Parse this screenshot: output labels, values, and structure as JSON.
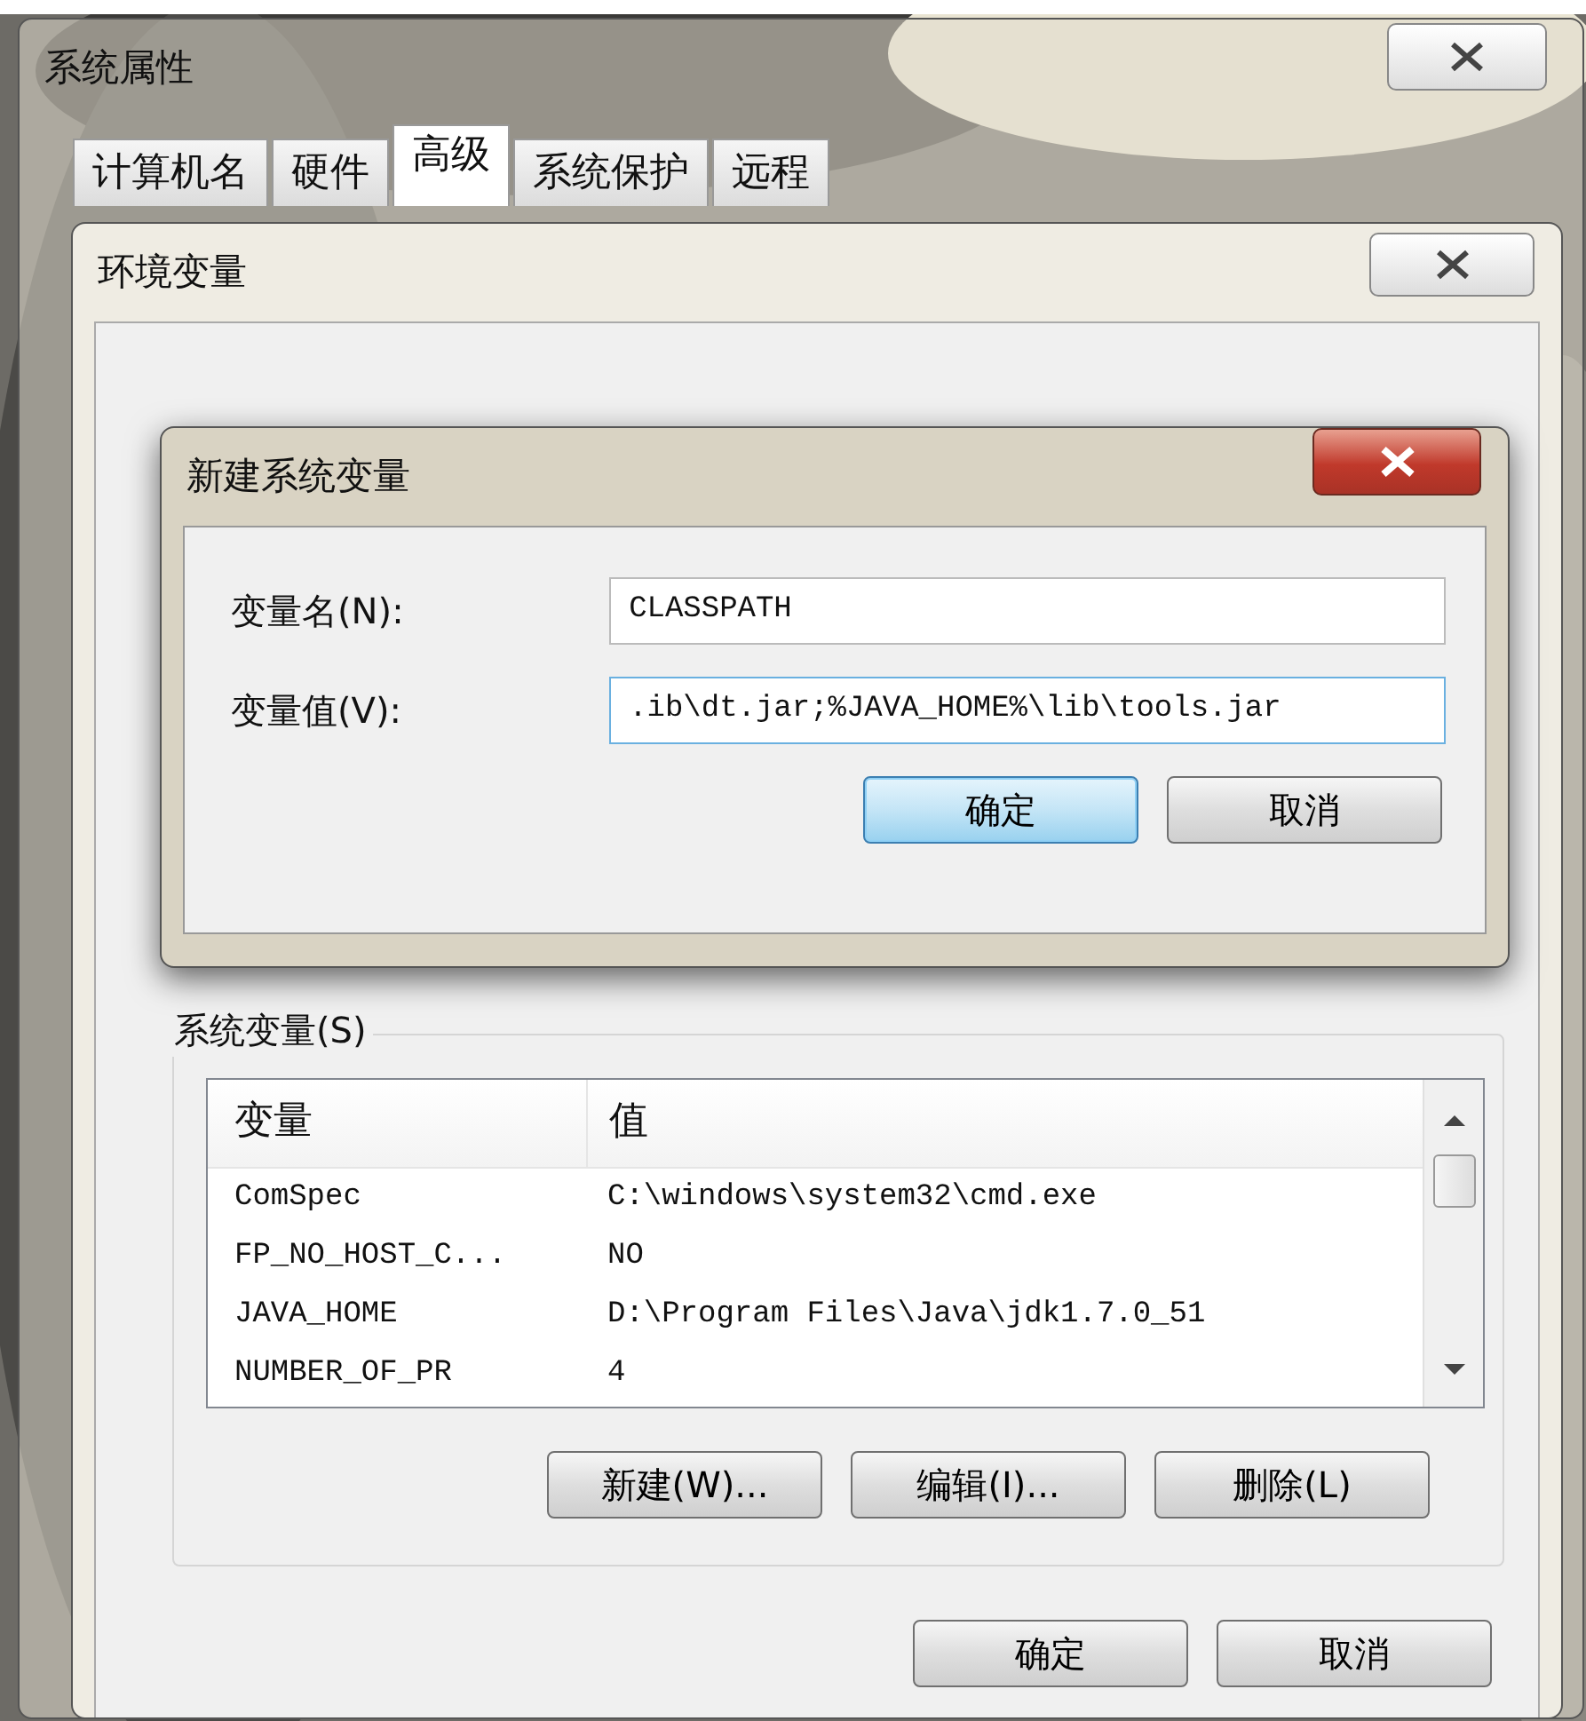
{
  "system_properties": {
    "title": "系统属性",
    "tabs": [
      {
        "label": "计算机名",
        "selected": false
      },
      {
        "label": "硬件",
        "selected": false
      },
      {
        "label": "高级",
        "selected": true
      },
      {
        "label": "系统保护",
        "selected": false
      },
      {
        "label": "远程",
        "selected": false
      }
    ]
  },
  "environment_variables": {
    "title": "环境变量",
    "system_variables": {
      "legend": "系统变量(S)",
      "columns": [
        "变量",
        "值"
      ],
      "rows": [
        {
          "name": "ComSpec",
          "value": "C:\\windows\\system32\\cmd.exe"
        },
        {
          "name": "FP_NO_HOST_C...",
          "value": "NO"
        },
        {
          "name": "JAVA_HOME",
          "value": "D:\\Program Files\\Java\\jdk1.7.0_51"
        },
        {
          "name": "NUMBER_OF_PR",
          "value": "4"
        }
      ],
      "buttons": [
        "新建(W)...",
        "编辑(I)...",
        "删除(L)"
      ]
    },
    "buttons": [
      "确定",
      "取消"
    ]
  },
  "new_system_variable": {
    "title": "新建系统变量",
    "fields": [
      {
        "label": "变量名(N):",
        "value": "CLASSPATH"
      },
      {
        "label": "变量值(V):",
        "value": ".ib\\dt.jar;%JAVA_HOME%\\lib\\tools.jar"
      }
    ],
    "buttons": [
      {
        "label": "确定",
        "default": true
      },
      {
        "label": "取消",
        "default": false
      }
    ]
  }
}
